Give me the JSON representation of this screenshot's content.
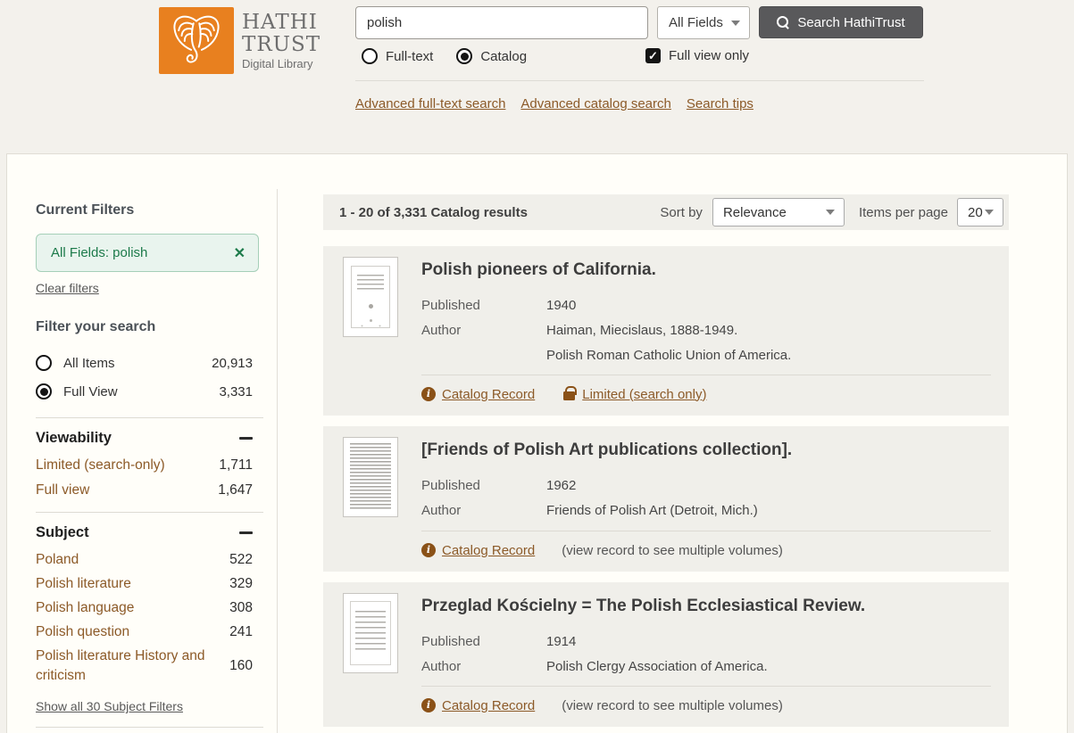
{
  "brand": {
    "name_line1": "HATHI",
    "name_line2": "TRUST",
    "tagline": "Digital Library"
  },
  "search_bar": {
    "query": "polish",
    "field_select": "All Fields",
    "button_label": "Search HathiTrust",
    "options": [
      {
        "label": "Full-text",
        "selected": false
      },
      {
        "label": "Catalog",
        "selected": true
      }
    ],
    "full_view_checkbox": {
      "label": "Full view only",
      "checked": true
    },
    "links": [
      "Advanced full-text search",
      "Advanced catalog search",
      "Search tips"
    ]
  },
  "sidebar": {
    "current_filters_title": "Current Filters",
    "active_filter": "All Fields: polish",
    "clear_filters_label": "Clear filters",
    "filter_search_title": "Filter your search",
    "filter_options": [
      {
        "label": "All Items",
        "count": "20,913",
        "selected": false
      },
      {
        "label": "Full View",
        "count": "3,331",
        "selected": true
      }
    ],
    "viewability": {
      "title": "Viewability",
      "items": [
        {
          "label": "Limited (search-only)",
          "count": "1,711"
        },
        {
          "label": "Full view",
          "count": "1,647"
        }
      ]
    },
    "subject": {
      "title": "Subject",
      "items": [
        {
          "label": "Poland",
          "count": "522"
        },
        {
          "label": "Polish literature",
          "count": "329"
        },
        {
          "label": "Polish language",
          "count": "308"
        },
        {
          "label": "Polish question",
          "count": "241"
        },
        {
          "label": "Polish literature History and criticism",
          "count": "160"
        }
      ],
      "show_all_label": "Show all 30 Subject Filters"
    }
  },
  "results": {
    "summary": "1 - 20 of 3,331 Catalog results",
    "sort_by_label": "Sort by",
    "sort_value": "Relevance",
    "items_per_page_label": "Items per page",
    "items_per_page_value": "20",
    "cards": [
      {
        "title": "Polish pioneers of California.",
        "published_label": "Published",
        "published": "1940",
        "author_label": "Author",
        "authors": [
          "Haiman, Miecislaus, 1888-1949.",
          "Polish Roman Catholic Union of America."
        ],
        "links": [
          {
            "label": "Catalog Record",
            "icon": "info-icon"
          },
          {
            "label": "Limited (search only)",
            "icon": "lock-icon"
          }
        ],
        "note": "",
        "thumb": "title-page"
      },
      {
        "title": "[Friends of Polish Art publications collection].",
        "published_label": "Published",
        "published": "1962",
        "author_label": "Author",
        "authors": [
          "Friends of Polish Art (Detroit, Mich.)"
        ],
        "links": [
          {
            "label": "Catalog Record",
            "icon": "info-icon"
          }
        ],
        "note": "(view record to see multiple volumes)",
        "thumb": "text-page"
      },
      {
        "title": "Przeglad Kościelny = The Polish Ecclesiastical Review.",
        "published_label": "Published",
        "published": "1914",
        "author_label": "Author",
        "authors": [
          "Polish Clergy Association of America."
        ],
        "links": [
          {
            "label": "Catalog Record",
            "icon": "info-icon"
          }
        ],
        "note": "(view record to see multiple volumes)",
        "thumb": "toc-page"
      }
    ]
  },
  "colors": {
    "accent_orange": "#e8801f",
    "link_brown": "#8c5a28",
    "icon_brown": "#8a5117",
    "green_text": "#1c7a4a",
    "chip_bg": "#e9f4ee",
    "chip_border": "#a5cfb8",
    "button_gray": "#59595b"
  }
}
